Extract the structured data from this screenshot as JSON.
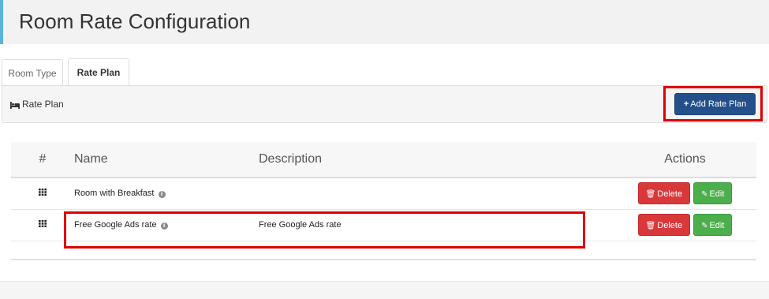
{
  "page": {
    "title": "Room Rate Configuration"
  },
  "tabs": [
    {
      "label": "Room Type",
      "active": false
    },
    {
      "label": "Rate Plan",
      "active": true
    }
  ],
  "panel": {
    "icon": "bed-icon",
    "label": "Rate Plan",
    "add_button": {
      "icon": "plus-icon",
      "label": "Add Rate Plan"
    }
  },
  "table": {
    "headers": {
      "num": "#",
      "name": "Name",
      "description": "Description",
      "actions": "Actions"
    },
    "rows": [
      {
        "icon": "grid-icon",
        "name": "Room with Breakfast",
        "info_icon": "info-icon",
        "description": "",
        "delete_label": "Delete",
        "edit_label": "Edit"
      },
      {
        "icon": "grid-icon",
        "name": "Free Google Ads rate",
        "info_icon": "info-icon",
        "description": "Free Google Ads rate",
        "delete_label": "Delete",
        "edit_label": "Edit"
      }
    ]
  },
  "colors": {
    "accent_border": "#5bb4d8",
    "primary_button": "#23508b",
    "delete_button": "#d9383a",
    "edit_button": "#4cae4c",
    "highlight": "#e00000"
  }
}
